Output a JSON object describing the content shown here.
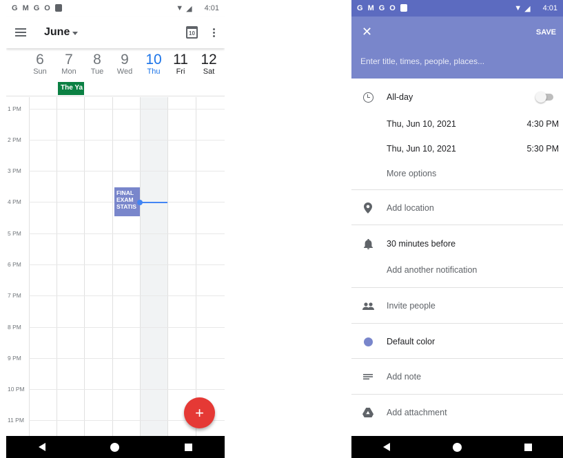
{
  "calendar": {
    "status_bar": {
      "app_icons": [
        "G",
        "M",
        "G",
        "O"
      ],
      "time": "4:01"
    },
    "appbar": {
      "month": "June",
      "today_badge": "10"
    },
    "days": [
      {
        "num": "6",
        "name": "Sun"
      },
      {
        "num": "7",
        "name": "Mon"
      },
      {
        "num": "8",
        "name": "Tue"
      },
      {
        "num": "9",
        "name": "Wed"
      },
      {
        "num": "10",
        "name": "Thu"
      },
      {
        "num": "11",
        "name": "Fri"
      },
      {
        "num": "12",
        "name": "Sat"
      }
    ],
    "allday_event": "The Ya",
    "hours": [
      "1 PM",
      "2 PM",
      "3 PM",
      "4 PM",
      "5 PM",
      "6 PM",
      "7 PM",
      "8 PM",
      "9 PM",
      "10 PM",
      "11 PM"
    ],
    "event": {
      "line1": "FINAL",
      "line2": "EXAM",
      "line3": "STATIS"
    },
    "fab_label": "+"
  },
  "editor": {
    "status_bar": {
      "app_icons": [
        "G",
        "M",
        "G",
        "O"
      ],
      "time": "4:01"
    },
    "close_label": "✕",
    "save_label": "SAVE",
    "title_placeholder": "Enter title, times, people, places...",
    "all_day_label": "All-day",
    "start_date": "Thu, Jun 10, 2021",
    "start_time": "4:30 PM",
    "end_date": "Thu, Jun 10, 2021",
    "end_time": "5:30 PM",
    "more_options": "More options",
    "add_location": "Add location",
    "notification": "30 minutes before",
    "add_notification": "Add another notification",
    "invite_people": "Invite people",
    "color_label": "Default color",
    "add_note": "Add note",
    "add_attachment": "Add attachment"
  }
}
